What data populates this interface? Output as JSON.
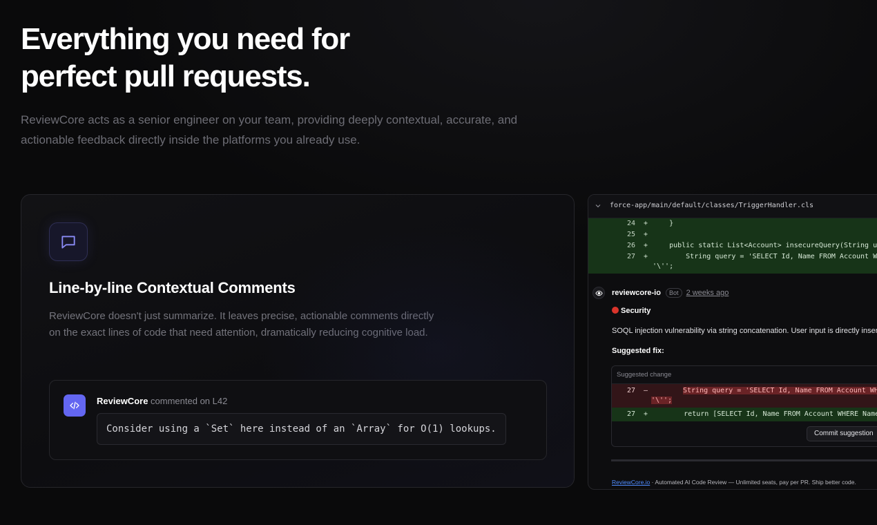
{
  "hero": {
    "title_line1": "Everything you need for",
    "title_line2": "perfect pull requests.",
    "subtitle": "ReviewCore acts as a senior engineer on your team, providing deeply contextual, accurate, and actionable feedback directly inside the platforms you already use."
  },
  "feature": {
    "icon": "message-square-icon",
    "title": "Line-by-line Contextual Comments",
    "description": "ReviewCore doesn't just summarize. It leaves precise, actionable comments directly on the exact lines of code that need attention, dramatically reducing cognitive load.",
    "comment": {
      "avatar_icon": "code-icon",
      "author": "ReviewCore",
      "meta": "commented on L42",
      "body": "Consider using a `Set` here instead of an `Array` for O(1) lookups."
    }
  },
  "pr_panel": {
    "file_path": "force-app/main/default/classes/TriggerHandler.cls",
    "diff_lines": [
      {
        "num": "24",
        "sign": "+",
        "code": "    }"
      },
      {
        "num": "25",
        "sign": "+",
        "code": ""
      },
      {
        "num": "26",
        "sign": "+",
        "code": "    public static List<Account> insecureQuery(String userInput) {"
      },
      {
        "num": "27",
        "sign": "+",
        "code": "        String query = 'SELECT Id, Name FROM Account WHERE Name = '"
      },
      {
        "num": "",
        "sign": "",
        "code": "'\\'';"
      }
    ],
    "review": {
      "user": "reviewcore-io",
      "badge": "Bot",
      "time": "2 weeks ago",
      "category": "Security",
      "issue": "SOQL injection vulnerability via string concatenation. User input is directly inserted into the query.",
      "fix_label": "Suggested fix:",
      "suggest_header": "Suggested change",
      "del_num": "27",
      "del_sign": "–",
      "del_code_pre": "        ",
      "del_code": "String query = 'SELECT Id, Name FROM Account WHERE Name = '",
      "del_code_2": "'\\'';",
      "add_num": "27",
      "add_sign": "+",
      "add_code": "        return [SELECT Id, Name FROM Account WHERE Name = :userInput];",
      "commit_button": "Commit suggestion"
    },
    "footer": {
      "link": "ReviewCore.io",
      "text": " · Automated AI Code Review — Unlimited seats, pay per PR. Ship better code."
    }
  },
  "colors": {
    "background": "#0a0a0b",
    "accent": "#6366f1",
    "diff_add": "#173418",
    "diff_del": "#321518",
    "security_red": "#d9342b",
    "link": "#4f8cff"
  }
}
